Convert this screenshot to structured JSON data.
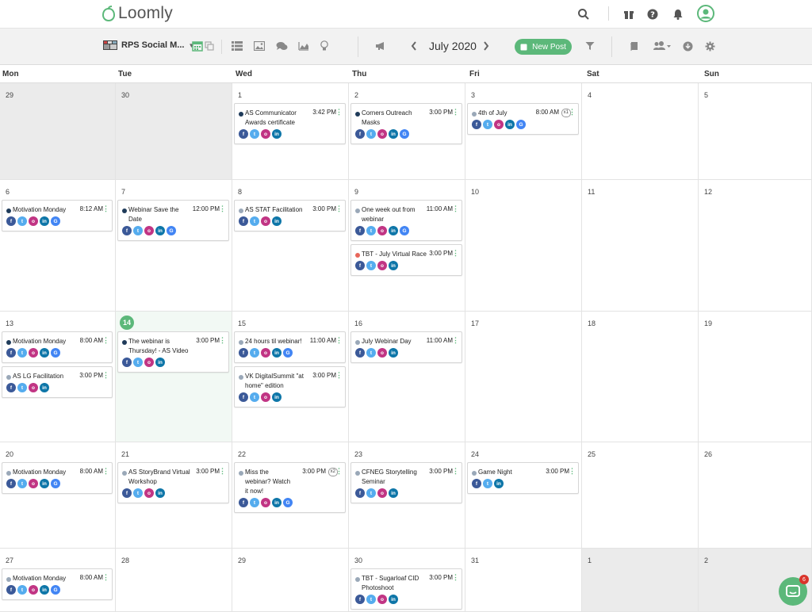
{
  "app": {
    "name": "Loomly"
  },
  "toolbar": {
    "account_name": "RPS Social M...",
    "month": "July 2020",
    "new_post_label": "New Post"
  },
  "weekdays": [
    "Mon",
    "Tue",
    "Wed",
    "Thu",
    "Fri",
    "Sat",
    "Sun"
  ],
  "weeks": [
    {
      "days": [
        {
          "num": "29",
          "other": true,
          "posts": []
        },
        {
          "num": "30",
          "other": true,
          "posts": []
        },
        {
          "num": "1",
          "posts": [
            {
              "title": [
                "AS Communicator",
                "Awards certificate"
              ],
              "time": "3:42 PM",
              "dot": "#1f3b5a",
              "socials": [
                "fb",
                "tw",
                "ig",
                "li"
              ]
            }
          ]
        },
        {
          "num": "2",
          "posts": [
            {
              "title": [
                "Corners Outreach",
                "Masks"
              ],
              "time": "3:00 PM",
              "dot": "#1f3b5a",
              "socials": [
                "fb",
                "tw",
                "ig",
                "li",
                "gg"
              ]
            }
          ]
        },
        {
          "num": "3",
          "posts": [
            {
              "title": [
                "4th of July"
              ],
              "time": "8:00 AM",
              "dot": "#9aa8b8",
              "mult": "x1",
              "socials": [
                "fb",
                "tw",
                "ig",
                "li",
                "gg"
              ]
            }
          ]
        },
        {
          "num": "4",
          "posts": []
        },
        {
          "num": "5",
          "posts": []
        }
      ]
    },
    {
      "days": [
        {
          "num": "6",
          "posts": [
            {
              "title": [
                "Motivation Monday"
              ],
              "time": "8:12 AM",
              "dot": "#1f3b5a",
              "socials": [
                "fb",
                "tw",
                "ig",
                "li",
                "gg"
              ]
            }
          ]
        },
        {
          "num": "7",
          "posts": [
            {
              "title": [
                "Webinar Save the",
                "Date"
              ],
              "time": "12:00 PM",
              "dot": "#1f3b5a",
              "socials": [
                "fb",
                "tw",
                "ig",
                "li",
                "gg"
              ]
            }
          ]
        },
        {
          "num": "8",
          "posts": [
            {
              "title": [
                "AS STAT Facilitation"
              ],
              "time": "3:00 PM",
              "dot": "#9aa8b8",
              "socials": [
                "fb",
                "tw",
                "ig",
                "li"
              ]
            }
          ]
        },
        {
          "num": "9",
          "posts": [
            {
              "title": [
                "One week out from",
                "webinar"
              ],
              "time": "11:00 AM",
              "dot": "#9aa8b8",
              "socials": [
                "fb",
                "tw",
                "ig",
                "li",
                "gg"
              ]
            },
            {
              "title": [
                "TBT - July Virtual Race"
              ],
              "time": "3:00 PM",
              "dot": "#e8665a",
              "socials": [
                "fb",
                "tw",
                "ig",
                "li"
              ]
            }
          ]
        },
        {
          "num": "10",
          "posts": []
        },
        {
          "num": "11",
          "posts": []
        },
        {
          "num": "12",
          "posts": []
        }
      ]
    },
    {
      "days": [
        {
          "num": "13",
          "posts": [
            {
              "title": [
                "Motivation Monday"
              ],
              "time": "8:00 AM",
              "dot": "#1f3b5a",
              "socials": [
                "fb",
                "tw",
                "ig",
                "li",
                "gg"
              ]
            },
            {
              "title": [
                "AS LG Facilitation"
              ],
              "time": "3:00 PM",
              "dot": "#9aa8b8",
              "socials": [
                "fb",
                "tw",
                "ig",
                "li"
              ]
            }
          ]
        },
        {
          "num": "14",
          "today": true,
          "posts": [
            {
              "title": [
                "The webinar is",
                "Thursday! - AS Video"
              ],
              "time": "3:00 PM",
              "dot": "#1f3b5a",
              "socials": [
                "fb",
                "tw",
                "ig",
                "li"
              ]
            }
          ]
        },
        {
          "num": "15",
          "posts": [
            {
              "title": [
                "24 hours til webinar!"
              ],
              "time": "11:00 AM",
              "dot": "#9aa8b8",
              "socials": [
                "fb",
                "tw",
                "ig",
                "li",
                "gg"
              ]
            },
            {
              "title": [
                "VK DigitalSummit \"at",
                "home\" edition"
              ],
              "time": "3:00 PM",
              "dot": "#9aa8b8",
              "socials": [
                "fb",
                "tw",
                "ig",
                "li"
              ]
            }
          ]
        },
        {
          "num": "16",
          "posts": [
            {
              "title": [
                "July Webinar Day"
              ],
              "time": "11:00 AM",
              "dot": "#9aa8b8",
              "socials": [
                "fb",
                "tw",
                "ig",
                "li"
              ]
            }
          ]
        },
        {
          "num": "17",
          "posts": []
        },
        {
          "num": "18",
          "posts": []
        },
        {
          "num": "19",
          "posts": []
        }
      ]
    },
    {
      "days": [
        {
          "num": "20",
          "posts": [
            {
              "title": [
                "Motivation Monday"
              ],
              "time": "8:00 AM",
              "dot": "#9aa8b8",
              "socials": [
                "fb",
                "tw",
                "ig",
                "li",
                "gg"
              ]
            }
          ]
        },
        {
          "num": "21",
          "posts": [
            {
              "title": [
                "AS StoryBrand Virtual",
                "Workshop"
              ],
              "time": "3:00 PM",
              "dot": "#9aa8b8",
              "socials": [
                "fb",
                "tw",
                "ig",
                "li"
              ]
            }
          ]
        },
        {
          "num": "22",
          "posts": [
            {
              "title": [
                "Miss the",
                "webinar? Watch",
                "it now!"
              ],
              "time": "3:00 PM",
              "dot": "#9aa8b8",
              "mult": "x2",
              "socials": [
                "fb",
                "tw",
                "ig",
                "li",
                "gg"
              ]
            }
          ]
        },
        {
          "num": "23",
          "posts": [
            {
              "title": [
                "CFNEG Storytelling",
                "Seminar"
              ],
              "time": "3:00 PM",
              "dot": "#9aa8b8",
              "socials": [
                "fb",
                "tw",
                "ig",
                "li"
              ]
            }
          ]
        },
        {
          "num": "24",
          "posts": [
            {
              "title": [
                "Game Night"
              ],
              "time": "3:00 PM",
              "dot": "#9aa8b8",
              "socials": [
                "fb",
                "tw",
                "li"
              ]
            }
          ]
        },
        {
          "num": "25",
          "posts": []
        },
        {
          "num": "26",
          "posts": []
        }
      ]
    },
    {
      "days": [
        {
          "num": "27",
          "posts": [
            {
              "title": [
                "Motivation Monday"
              ],
              "time": "8:00 AM",
              "dot": "#9aa8b8",
              "socials": [
                "fb",
                "tw",
                "ig",
                "li",
                "gg"
              ]
            }
          ]
        },
        {
          "num": "28",
          "posts": []
        },
        {
          "num": "29",
          "posts": []
        },
        {
          "num": "30",
          "posts": [
            {
              "title": [
                "TBT - Sugarloaf CID",
                "Photoshoot"
              ],
              "time": "3:00 PM",
              "dot": "#9aa8b8",
              "socials": [
                "fb",
                "tw",
                "ig",
                "li"
              ]
            }
          ]
        },
        {
          "num": "31",
          "posts": []
        },
        {
          "num": "1",
          "other": true,
          "posts": []
        },
        {
          "num": "2",
          "other": true,
          "posts": []
        }
      ]
    }
  ],
  "social_letters": {
    "fb": "f",
    "tw": "t",
    "ig": "o",
    "li": "in",
    "gg": "G"
  },
  "social_names": {
    "fb": "facebook-icon",
    "tw": "twitter-icon",
    "ig": "instagram-icon",
    "li": "linkedin-icon",
    "gg": "google-icon"
  },
  "chat": {
    "badge": "6"
  },
  "colors": {
    "accent": "#5cb87a"
  }
}
